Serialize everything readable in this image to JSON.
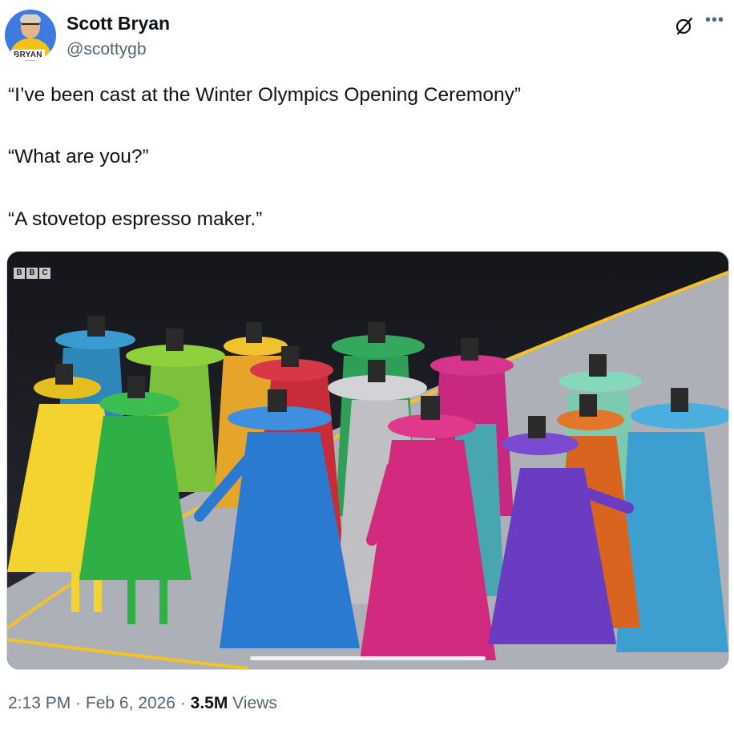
{
  "author": {
    "name": "Scott Bryan",
    "handle": "@scottygb",
    "avatar_badge": "BRYAN"
  },
  "icons": {
    "grok": "grok-icon",
    "more": "more-icon"
  },
  "tweet": {
    "lines": [
      "“I’ve been cast at the Winter Olympics Opening Ceremony”",
      "“What are you?”",
      "“A stovetop espresso maker.”"
    ]
  },
  "media": {
    "watermark": [
      "B",
      "B",
      "C"
    ]
  },
  "meta": {
    "time": "2:13 PM",
    "sep1": " · ",
    "date": "Feb 6, 2026",
    "sep2": " · ",
    "views_count": "3.5M",
    "views_label": " Views"
  },
  "colors": {
    "text_primary": "#0f1419",
    "text_secondary": "#536471",
    "border": "#cfd9de"
  }
}
